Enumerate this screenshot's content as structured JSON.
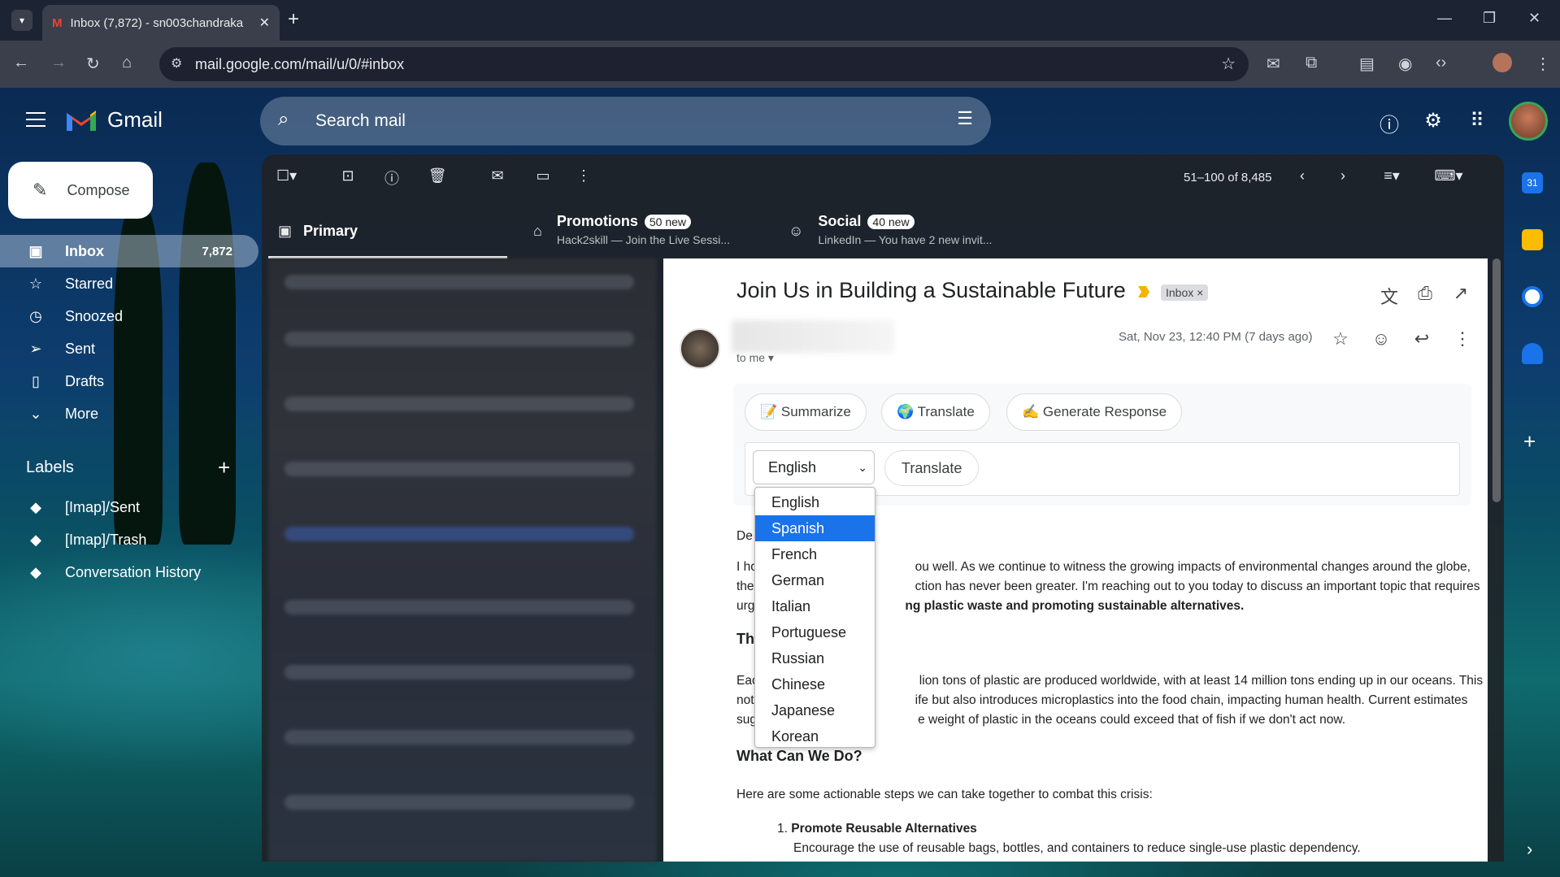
{
  "browser": {
    "tab_title": "Inbox (7,872) - sn003chandraka",
    "url": "mail.google.com/mail/u/0/#inbox"
  },
  "gmail": {
    "brand": "Gmail",
    "search_placeholder": "Search mail",
    "compose_label": "Compose",
    "nav": [
      {
        "label": "Inbox",
        "count": "7,872",
        "icon": "inbox-icon"
      },
      {
        "label": "Starred",
        "count": "",
        "icon": "star-icon"
      },
      {
        "label": "Snoozed",
        "count": "",
        "icon": "clock-icon"
      },
      {
        "label": "Sent",
        "count": "",
        "icon": "send-icon"
      },
      {
        "label": "Drafts",
        "count": "",
        "icon": "draft-icon"
      },
      {
        "label": "More",
        "count": "",
        "icon": "chevron-down-icon"
      }
    ],
    "labels_heading": "Labels",
    "labels": [
      "[Imap]/Sent",
      "[Imap]/Trash",
      "Conversation History"
    ],
    "pager": "51–100 of 8,485",
    "tabs": [
      {
        "title": "Primary",
        "badge": "",
        "snippet": ""
      },
      {
        "title": "Promotions",
        "badge": "50 new",
        "snippet": "Hack2skill — Join the Live Sessi..."
      },
      {
        "title": "Social",
        "badge": "40 new",
        "snippet": "LinkedIn — You have 2 new invit..."
      }
    ]
  },
  "email": {
    "subject": "Join Us in Building a Sustainable Future",
    "chip": "Inbox",
    "to": "to me",
    "date": "Sat, Nov 23, 12:40 PM (7 days ago)",
    "ai_buttons": [
      "📝 Summarize",
      "🌍 Translate",
      "✍️ Generate Response"
    ],
    "language_selected": "English",
    "translate_button": "Translate",
    "greeting": "De",
    "p1_l1": "I ho                                             ou well. As we continue to witness the growing impacts of environmental changes around the globe,",
    "p1_l2": "the                                              ction has never been greater. I'm reaching out to you today to discuss an important topic that requires",
    "p1_l3_a": "urg",
    "p1_l3_b": "ng plastic waste and promoting sustainable alternatives.",
    "h_crisis_a": "Th",
    "h_crisis_b": "n",
    "p2_l1": "Eac                                              lion tons of plastic are produced worldwide, with at least 14 million tons ending up in our oceans. This",
    "p2_l2": "not                                              ife but also introduces microplastics into the food chain, impacting human health. Current estimates",
    "p2_l3": "sug                                              e weight of plastic in the oceans could exceed that of fish if we don't act now.",
    "h_what": "What Can We Do?",
    "p3": "Here are some actionable steps we can take together to combat this crisis:",
    "li1_num": "1.",
    "li1_title": "Promote Reusable Alternatives",
    "li1_text": "Encourage the use of reusable bags, bottles, and containers to reduce single-use plastic dependency."
  },
  "dropdown": {
    "options": [
      "English",
      "Spanish",
      "French",
      "German",
      "Italian",
      "Portuguese",
      "Russian",
      "Chinese",
      "Japanese",
      "Korean"
    ],
    "highlighted": "Spanish"
  },
  "colors": {
    "accent": "#1a73e8",
    "important": "#f4b400",
    "avatar_ring": "#34a853"
  }
}
